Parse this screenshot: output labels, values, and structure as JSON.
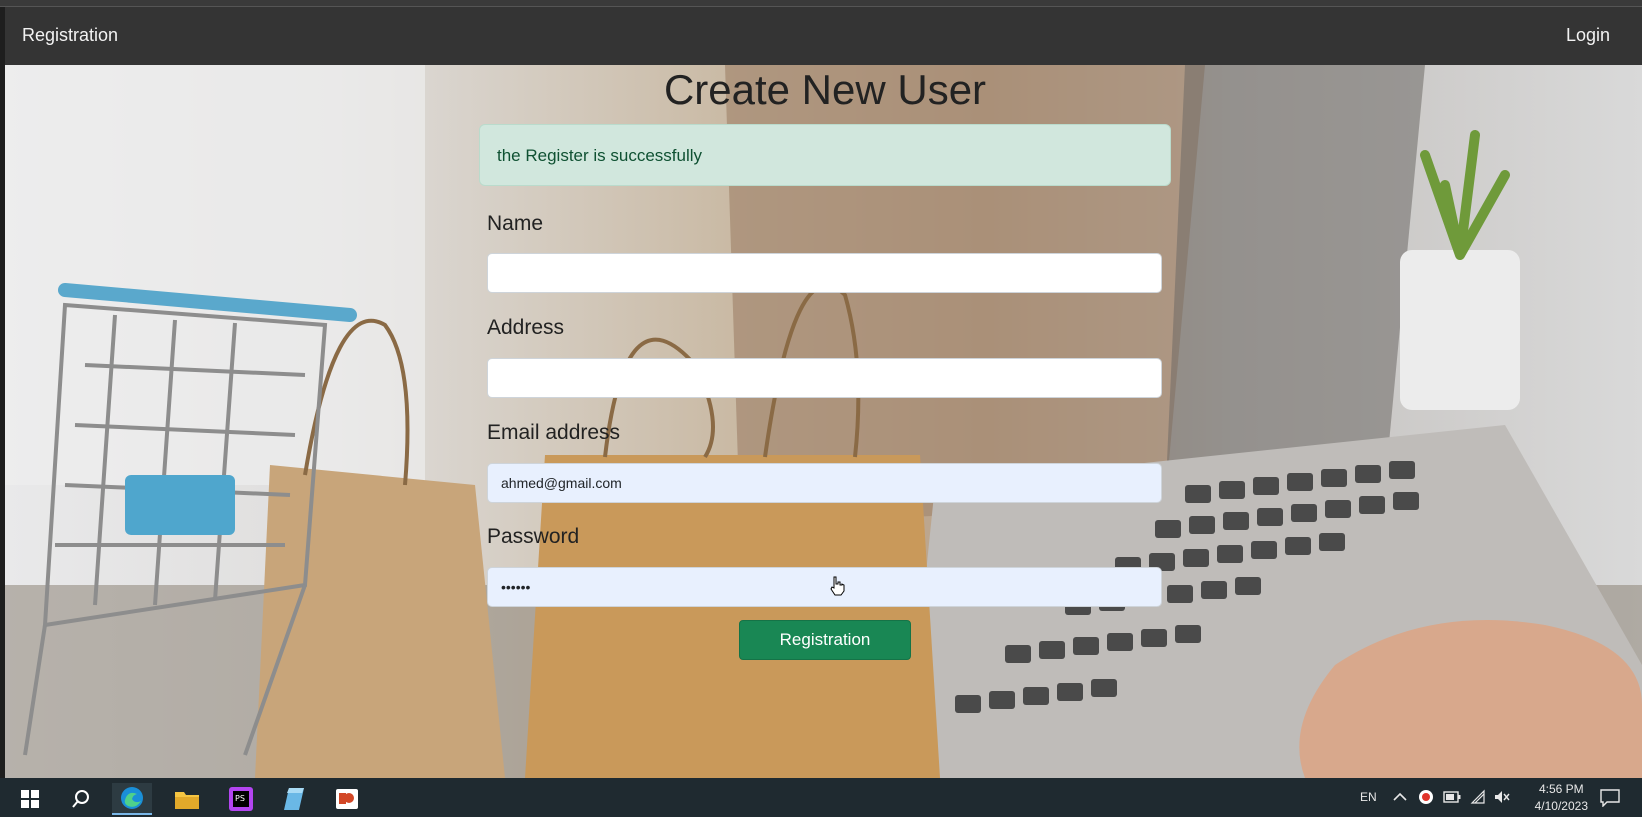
{
  "navbar": {
    "brand": "Registration",
    "login": "Login"
  },
  "page": {
    "title": "Create New User",
    "alert": "the Register is successfully"
  },
  "form": {
    "name_label": "Name",
    "name_value": "",
    "address_label": "Address",
    "address_value": "",
    "email_label": "Email address",
    "email_value": "ahmed@gmail.com",
    "password_label": "Password",
    "password_value": "••••••",
    "submit_label": "Registration"
  },
  "taskbar": {
    "icons": [
      "windows-start-icon",
      "search-icon",
      "edge-browser-icon",
      "file-explorer-icon",
      "phpstorm-icon",
      "notepad-icon",
      "powerpoint-icon"
    ],
    "language": "EN",
    "time": "4:56 PM",
    "date": "4/10/2023"
  },
  "colors": {
    "navbar": "#343434",
    "alert_bg": "#d1e7dd",
    "alert_text": "#0f5132",
    "button": "#198754",
    "taskbar": "#1f2a30"
  }
}
